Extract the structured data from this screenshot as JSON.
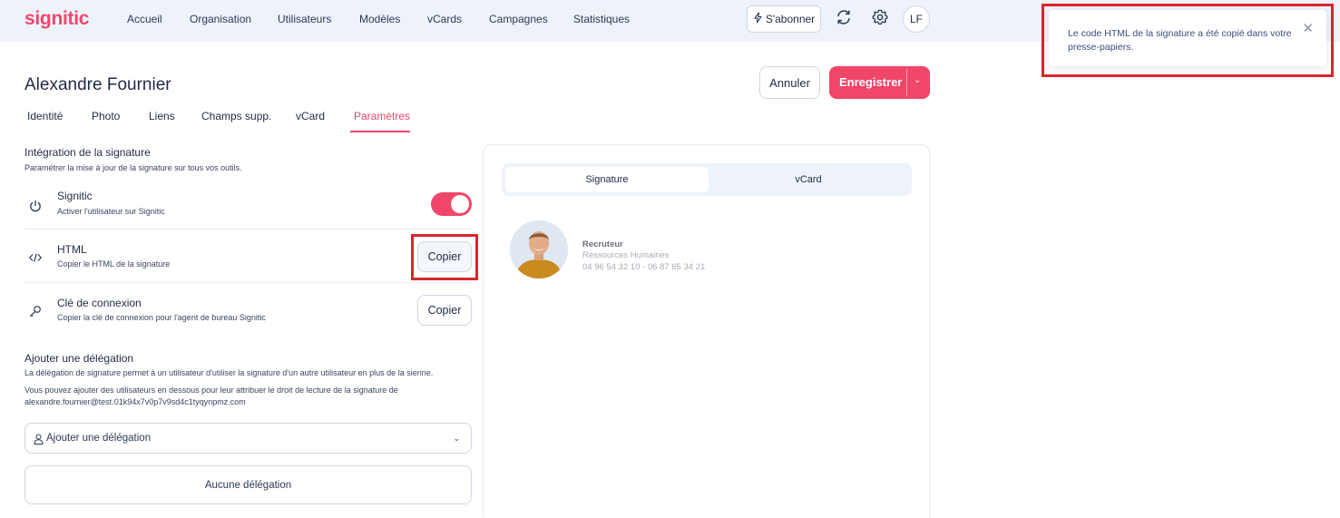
{
  "app": {
    "logo": "signitic"
  },
  "nav": {
    "items": [
      "Accueil",
      "Organisation",
      "Utilisateurs",
      "Modèles",
      "vCards",
      "Campagnes",
      "Statistiques"
    ],
    "subscribe_label": "S'abonner",
    "user_initials": "LF"
  },
  "toast": {
    "message": "Le code HTML de la signature a été copié dans votre presse-papiers."
  },
  "header": {
    "title": "Alexandre Fournier",
    "cancel_label": "Annuler",
    "save_label": "Enregistrer"
  },
  "tabs": [
    {
      "label": "Identité",
      "active": false
    },
    {
      "label": "Photo",
      "active": false
    },
    {
      "label": "Liens",
      "active": false
    },
    {
      "label": "Champs supp.",
      "active": false
    },
    {
      "label": "vCard",
      "active": false
    },
    {
      "label": "Paramètres",
      "active": true
    }
  ],
  "integration": {
    "title": "Intégration de la signature",
    "subtitle": "Paramétrer la mise à jour de la signature sur tous vos outils.",
    "rows": [
      {
        "title": "Signitic",
        "subtitle": "Activer l'utilisateur sur Signitic",
        "control": "toggle",
        "enabled": true
      },
      {
        "title": "HTML",
        "subtitle": "Copier le HTML de la signature",
        "control": "button",
        "button_label": "Copier"
      },
      {
        "title": "Clé de connexion",
        "subtitle": "Copier la clé de connexion pour l'agent de bureau Signitic",
        "control": "button",
        "button_label": "Copier"
      }
    ]
  },
  "delegation": {
    "title": "Ajouter une délégation",
    "description": "La délégation de signature permet à un utilisateur d'utiliser la signature d'un autre utilisateur en plus de la sienne.",
    "info_line1": "Vous pouvez ajouter des utilisateurs en dessous pour leur attribuer le droit de lecture de la signature de",
    "info_line2": "alexandre.fournier@test.01k94x7v0p7v9sd4c1tyqynpmz.com",
    "select_placeholder": "Ajouter une délégation",
    "empty_label": "Aucune délégation"
  },
  "preview": {
    "tabs": [
      "Signature",
      "vCard"
    ],
    "active_tab": "Signature",
    "role": "Recruteur",
    "department": "Ressources Humaines",
    "phones": "04 96 54 32 10 - 06 87 65 34 21"
  },
  "colors": {
    "accent": "#f0466a",
    "topbar_bg": "#eef3fb",
    "highlight": "#d9262c",
    "text": "#1f2a44"
  }
}
